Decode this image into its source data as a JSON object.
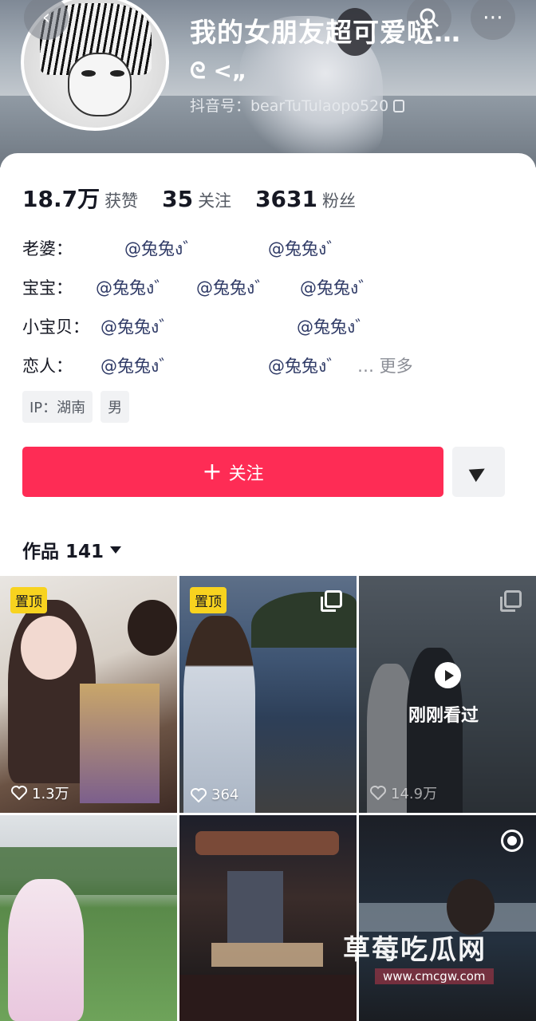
{
  "profile": {
    "nickname": "我的女朋友超可爱哒…",
    "signature": "ᘓ <„",
    "douyin_id": "抖音号：bearTuTulaopo520"
  },
  "stats": [
    {
      "value": "18.7万",
      "label": "获赞"
    },
    {
      "value": "35",
      "label": "关注"
    },
    {
      "value": "3631",
      "label": "粉丝"
    }
  ],
  "bio": [
    {
      "label": "老婆：",
      "mentions": [
        "@兔兔ง゛",
        "@兔兔ง゛"
      ]
    },
    {
      "label": "宝宝：",
      "mentions": [
        "@兔兔ง゛",
        "@兔兔ง゛",
        "@兔兔ง゛"
      ]
    },
    {
      "label": "小宝贝：",
      "mentions": [
        "@兔兔ง゛",
        "@兔兔ง゛"
      ]
    },
    {
      "label": "恋人：",
      "mentions": [
        "@兔兔ง゛",
        "@兔兔ง゛"
      ],
      "more": "… 更多"
    }
  ],
  "tags": [
    "IP：湖南",
    "男"
  ],
  "actions": {
    "follow_label": "关注"
  },
  "works": {
    "title": "作品 141"
  },
  "grid": [
    {
      "pinned_label": "置顶",
      "likes": "1.3万"
    },
    {
      "pinned_label": "置顶",
      "likes": "364"
    },
    {
      "likes": "14.9万",
      "recent_label": "刚刚看过"
    },
    {},
    {},
    {}
  ],
  "watermark": {
    "text": "草莓吃瓜网",
    "url": "www.cmcgw.com"
  }
}
